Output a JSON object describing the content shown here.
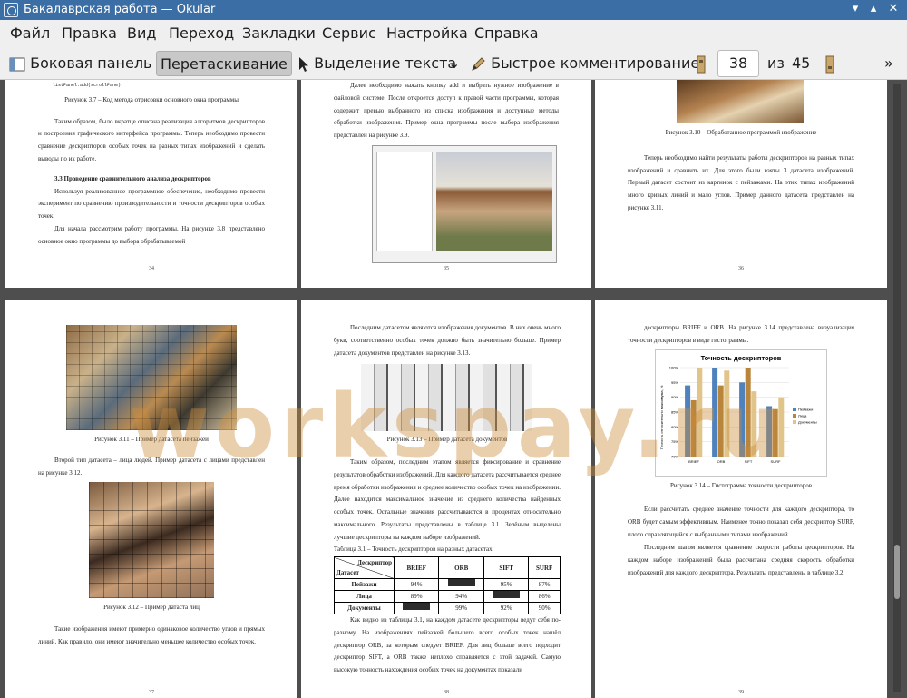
{
  "window": {
    "title": "Бакалаврская работа — Okular"
  },
  "menu": [
    "Файл",
    "Правка",
    "Вид",
    "Переход",
    "Закладки",
    "Сервис",
    "Настройка",
    "Справка"
  ],
  "toolbar": {
    "sidebar": "Боковая панель",
    "drag": "Перетаскивание",
    "select": "Выделение текста",
    "annotate": "Быстрое комментирование",
    "page_current": "38",
    "page_of": "из",
    "page_total": "45"
  },
  "watermark": "workspay.ru",
  "pages": {
    "p34": {
      "code": "listPanel.add(scrollPane);",
      "cap": "Рисунок 3.7 – Код метода отрисовки основного окна программы",
      "p1": "Таким образом, было вкратце описана реализация алгоритмов дескрипторов и построения графического интерфейса программы. Теперь необходимо провести сравнение дескрипторов особых точек на разных типах изображений и сделать выводы по их работе.",
      "h": "3.3 Проведение сравнительного анализа дескрипторов",
      "p2": "Используя реализованное программное обеспечение, необходимо провести эксперимент по сравнению производительности и точности дескрипторов особых точек.",
      "p3": "Для начала рассмотрим работу программы. На рисунке 3.8 представлено основное окно программы до выбора обрабатываемой",
      "num": "34"
    },
    "p35": {
      "p1": "Далее необходимо нажать кнопку add и выбрать нужное изображение в файловой системе. После откроется доступ к правой части программы, которая содержит превью выбранного из списка изображения и доступные методы обработки изображения. Пример окна программы после выбора изображения представлен на рисунке 3.9.",
      "num": "35"
    },
    "p36": {
      "cap": "Рисунок 3.10 – Обработанное программой изображение",
      "p1": "Теперь необходимо найти результаты работы дескрипторов на разных типах изображений и сравнить их. Для этого были взяты 3 датасета изображений. Первый датасет состоит из картинок с пейзажами. На этих типах изображений много кривых линий и мало углов. Пример данного датасета представлен на рисунке 3.11.",
      "num": "36"
    },
    "p37": {
      "cap1": "Рисунок 3.11 – Пример датасета пейзажей",
      "p1": "Второй тип датасета – лица людей. Пример датасета с лицами представлен на рисунке 3.12.",
      "cap2": "Рисунок 3.12 – Пример датаста лиц",
      "p2": "Такие изображения имеют примерно одинаковое количество углов и прямых линий. Как правило, они имеют значительно меньшее количество особых точек.",
      "num": "37"
    },
    "p38": {
      "p1": "Последним датасетом являются изображения документов. В них очень много букв, соответственно особых точек должно быть значительно больше. Пример датасета документов представлен на рисунке 3.13.",
      "cap": "Рисунок 3.13 – Пример датасета документов",
      "p2": "Таким образом, последним этапом является фиксирование и сравнение результатов обработки изображений. Для каждого датасета рассчитывается среднее время обработки изображения и среднее количество особых точек на изображении. Далее находится максимальное значение из среднего количества найденных особых точек. Остальные значения рассчитываются в процентах относительно максимального. Результаты представлены в таблице 3.1. Зелёным выделены лучшие дескрипторы на каждом наборе изображений.",
      "tcap": "Таблица 3.1 – Точность дескрипторов на разных датасетах",
      "table": {
        "corner_top": "Дескриптор",
        "corner_bottom": "Датасет",
        "cols": [
          "BRIEF",
          "ORB",
          "SIFT",
          "SURF"
        ],
        "rows": [
          [
            "Пейзажи",
            "94%",
            "",
            "95%",
            "87%"
          ],
          [
            "Лица",
            "89%",
            "94%",
            "",
            "86%"
          ],
          [
            "Документы",
            "",
            "99%",
            "92%",
            "90%"
          ]
        ]
      },
      "p3": "Как видно из таблицы 3.1, на каждом датасете дескрипторы ведут себя по-разному. На изображениях пейзажей большего всего особых точек нашёл дескриптор ORB, за которым следует BRIEF. Для лиц больше всего подходит дескриптор SIFT, а ORB также неплохо справляется с этой задачей. Самую высокую точность нахождения особых точек на документах показали",
      "num": "38"
    },
    "p39": {
      "p0": "дескрипторы BRIEF и ORB. На рисунке 3.14 представлена визуализация точности дескрипторов в виде гистограммы.",
      "cap": "Рисунок 3.14 – Гистограмма точности дескрипторов",
      "p1": "Если рассчитать среднее значение точности для каждого дескриптора, то ORB будет самым эффективным. Наименее точно показал себя дескриптор SURF, плохо справляющийся с выбранными типами изображений.",
      "p2": "Последним шагом является сравнение скорости работы дескрипторов. На каждом наборе изображений была рассчитана средняя скорость обработки изображений для каждого дескриптора. Результаты представлены в таблице 3.2.",
      "num": "39"
    }
  },
  "chart_data": {
    "type": "bar",
    "title": "Точность дескрипторов",
    "ylabel": "Точность относительно максимума, %",
    "categories": [
      "BRIEF",
      "ORB",
      "SIFT",
      "SURF"
    ],
    "series": [
      {
        "name": "Пейзажи",
        "values": [
          94,
          100,
          95,
          87
        ],
        "color": "#4f81bd"
      },
      {
        "name": "Лица",
        "values": [
          89,
          94,
          100,
          86
        ],
        "color": "#b9853b"
      },
      {
        "name": "Документы",
        "values": [
          100,
          99,
          92,
          90
        ],
        "color": "#e0c48a"
      }
    ],
    "ylim": [
      70,
      100
    ],
    "yticks": [
      "70%",
      "75%",
      "80%",
      "85%",
      "90%",
      "95%",
      "100%"
    ]
  }
}
